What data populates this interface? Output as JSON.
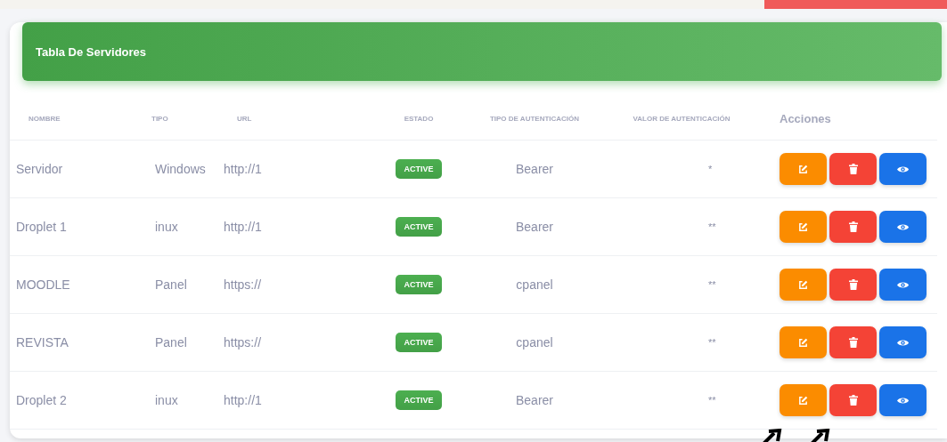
{
  "panel": {
    "title": "Tabla De Servidores"
  },
  "table": {
    "columns": [
      "NOMBRE",
      "TIPO",
      "URL",
      "ESTADO",
      "TIPO DE AUTENTICACIÓN",
      "VALOR DE AUTENTICACIÓN",
      "Acciones"
    ],
    "actions": [
      {
        "kind": "edit"
      },
      {
        "kind": "delete"
      },
      {
        "kind": "view"
      }
    ],
    "rows": [
      {
        "name": "Servidor",
        "type": "Windows",
        "url": "http://1",
        "status": "ACTIVE",
        "auth_type": "Bearer",
        "auth_value": "*"
      },
      {
        "name": "Droplet 1",
        "type": "inux",
        "url": "http://1",
        "status": "ACTIVE",
        "auth_type": "Bearer",
        "auth_value": "**"
      },
      {
        "name": "MOODLE",
        "type": "Panel",
        "url": "https://",
        "status": "ACTIVE",
        "auth_type": "cpanel",
        "auth_value": "**"
      },
      {
        "name": "REVISTA",
        "type": "Panel",
        "url": "https://",
        "status": "ACTIVE",
        "auth_type": "cpanel",
        "auth_value": "**"
      },
      {
        "name": "Droplet 2",
        "type": "inux",
        "url": "http://1",
        "status": "ACTIVE",
        "auth_type": "Bearer",
        "auth_value": "**"
      }
    ]
  }
}
